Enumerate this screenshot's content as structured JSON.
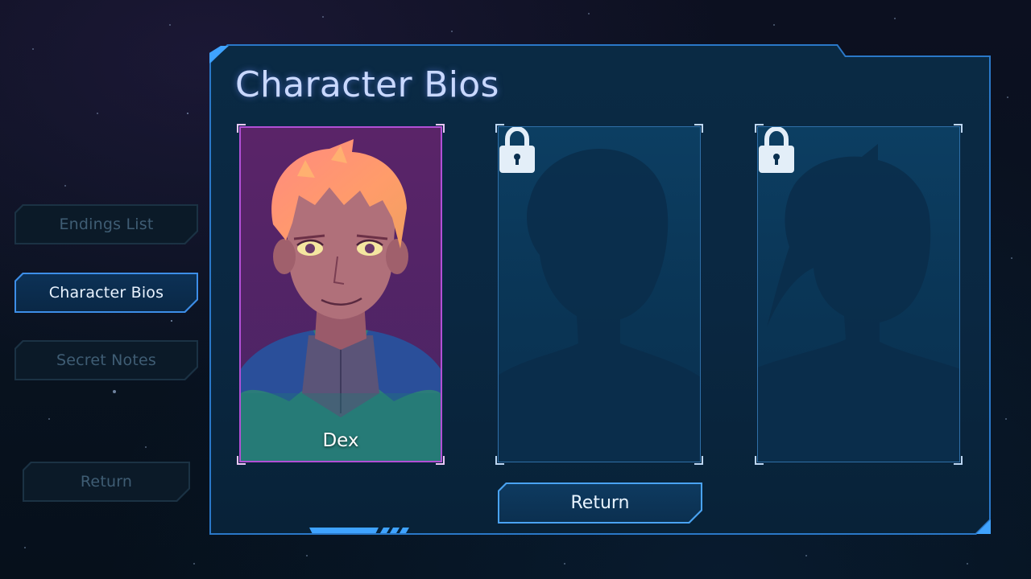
{
  "screen": {
    "title": "Character Bios"
  },
  "side_menu": {
    "items": [
      {
        "label": "Endings List",
        "active": false
      },
      {
        "label": "Character Bios",
        "active": true
      },
      {
        "label": "Secret Notes",
        "active": false
      }
    ],
    "return_label": "Return"
  },
  "cards": [
    {
      "name": "Dex",
      "state": "unlocked",
      "icon": "character-portrait"
    },
    {
      "name": "",
      "state": "locked",
      "icon": "lock-icon"
    },
    {
      "name": "",
      "state": "locked",
      "icon": "lock-icon"
    }
  ],
  "footer": {
    "return_label": "Return"
  },
  "colors": {
    "accent_blue": "#3fa3ff",
    "panel_bg": "#0a2741",
    "title_text": "#c9d8ff",
    "unlocked_frame": "#b24fd6"
  }
}
